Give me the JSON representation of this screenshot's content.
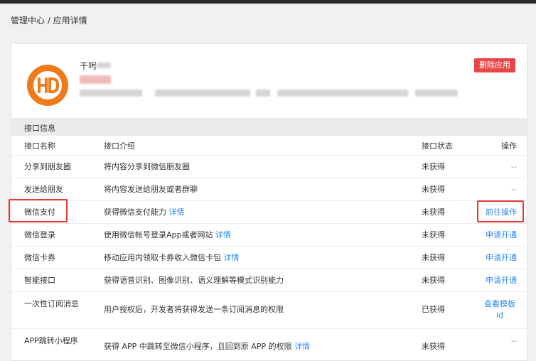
{
  "breadcrumb": "管理中心 / 应用详情",
  "app": {
    "name": "千呺",
    "delete_label": "删除应用",
    "colors": {
      "logo_orange": "#f07a1a",
      "delete_red": "#e84646",
      "link_blue": "#2d8cf0",
      "highlight_red": "#e53935"
    }
  },
  "section_title": "接口信息",
  "table": {
    "headers": {
      "name": "接口名称",
      "desc": "接口介绍",
      "status": "接口状态",
      "op": "操作"
    },
    "rows": [
      {
        "name": "分享到朋友圈",
        "desc": "将内容分享到微信朋友圈",
        "link": "",
        "status": "未获得",
        "op": "--",
        "op_is_link": false
      },
      {
        "name": "发送给朋友",
        "desc": "将内容发送给朋友或者群聊",
        "link": "",
        "status": "未获得",
        "op": "--",
        "op_is_link": false
      },
      {
        "name": "微信支付",
        "desc": "获得微信支付能力",
        "link": "详情",
        "status": "未获得",
        "op": "前往操作",
        "op_is_link": true
      },
      {
        "name": "微信登录",
        "desc": "使用微信帐号登录App或者网站",
        "link": "详情",
        "status": "未获得",
        "op": "申请开通",
        "op_is_link": true
      },
      {
        "name": "微信卡券",
        "desc": "移动应用内领取卡券收入微信卡包",
        "link": "详情",
        "status": "未获得",
        "op": "申请开通",
        "op_is_link": true
      },
      {
        "name": "智能接口",
        "desc": "获得语音识别、图像识别、语义理解等模式识别能力",
        "link": "",
        "status": "未获得",
        "op": "申请开通",
        "op_is_link": true
      },
      {
        "name": "一次性订阅消息",
        "desc": "用户授权后，开发者将获得发送一条订阅消息的权限",
        "link": "",
        "status": "已获得",
        "op": "查看模板id",
        "op_is_link": true
      },
      {
        "name": "APP跳转小程序",
        "desc": "获得 APP 中跳转至微信小程序，且回到原 APP 的权限",
        "link": "详情",
        "status": "未获得",
        "op": "--",
        "op_is_link": false
      }
    ]
  }
}
